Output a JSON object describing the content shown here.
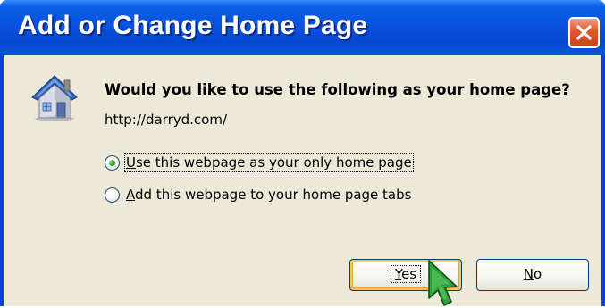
{
  "window": {
    "title": "Add or Change Home Page",
    "close_icon": "close-icon"
  },
  "dialog": {
    "icon": "house-icon",
    "question": "Would you like to use the following as your home page?",
    "url": "http://darryd.com/",
    "options": [
      {
        "mnemonic": "U",
        "rest": "se this webpage as your only home page",
        "selected": true
      },
      {
        "mnemonic": "A",
        "rest": "dd this webpage to your home page tabs",
        "selected": false
      }
    ]
  },
  "buttons": {
    "yes": {
      "mnemonic": "Y",
      "rest": "es"
    },
    "no": {
      "mnemonic": "N",
      "rest": "o"
    }
  },
  "colors": {
    "titlebar": "#0a55e0",
    "dialog_bg": "#ece9d8",
    "close_red": "#e2562e",
    "radio_selected": "#28a61d"
  }
}
